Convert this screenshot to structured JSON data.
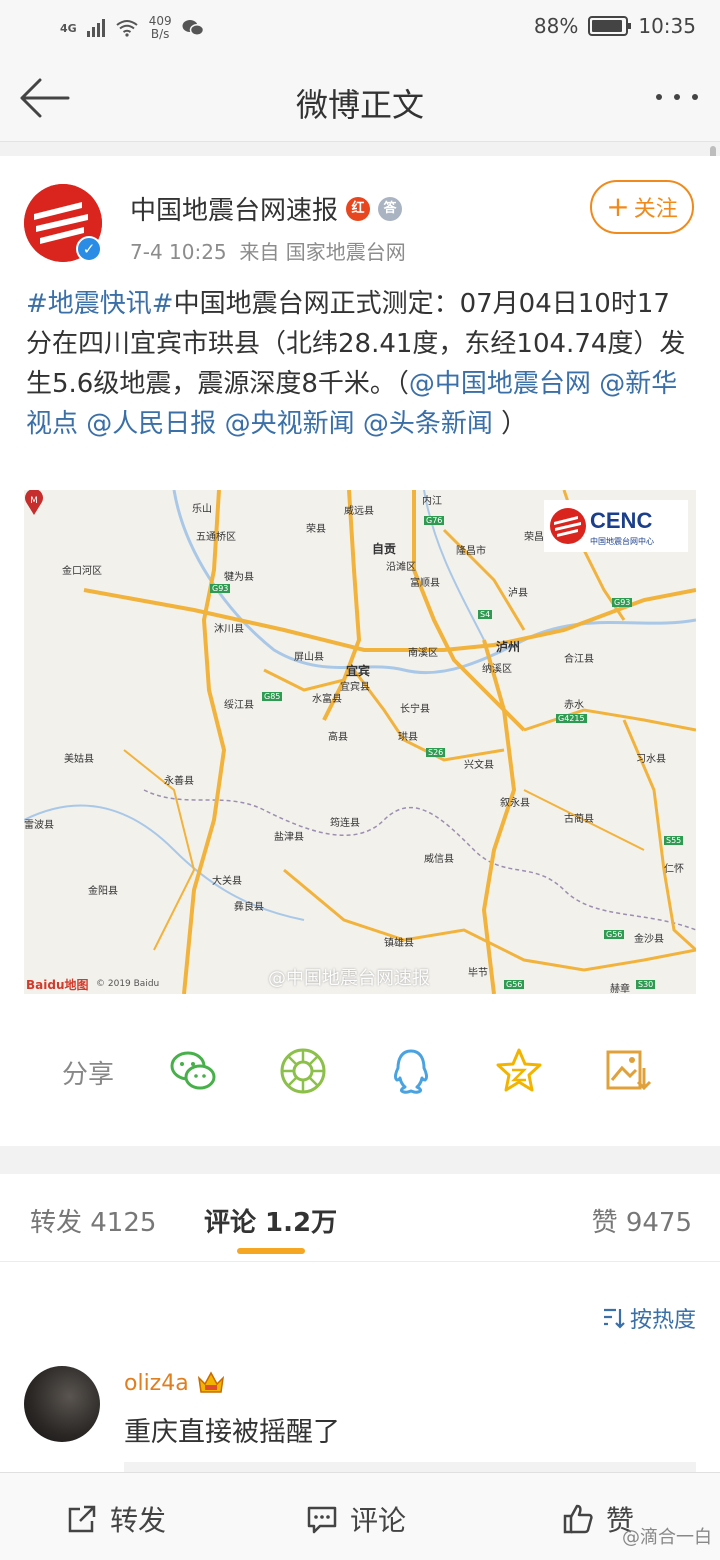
{
  "status": {
    "network": "4G",
    "speed_value": "409",
    "speed_unit": "B/s",
    "battery": "88%",
    "time": "10:35"
  },
  "nav": {
    "title": "微博正文"
  },
  "post": {
    "author": "中国地震台网速报",
    "badge_red": "红",
    "badge_gray": "答",
    "time": "7-4 10:25",
    "source": "来自 国家地震台网",
    "follow_label": "关注",
    "text": {
      "hashtag": "#地震快讯#",
      "body": "中国地震台网正式测定：07月04日10时17分在四川宜宾市珙县（北纬28.41度，东经104.74度）发生5.6级地震，震源深度8千米。（",
      "mention1": "@中国地震台网",
      "mention2": "@新华视点",
      "mention3": "@人民日报",
      "mention4": "@央视新闻",
      "mention5": "@头条新闻",
      "close": "）"
    },
    "map": {
      "logo_text": "CENC",
      "logo_sub": "中国地震台网中心",
      "baidu": "Baidu地图",
      "copyright": "© 2019 Baidu",
      "watermark": "@中国地震台网速报",
      "epicenter_mark": "M",
      "labels": [
        "乐山",
        "威远县",
        "内江",
        "荣县",
        "五通桥区",
        "自贡",
        "隆昌市",
        "荣昌",
        "沿滩区",
        "金口河区",
        "犍为县",
        "富顺县",
        "泸县",
        "沐川县",
        "泸州",
        "合江县",
        "屏山县",
        "宜宾",
        "南溪区",
        "纳溪区",
        "宜宾县",
        "水富县",
        "长宁县",
        "绥江县",
        "高县",
        "珙县",
        "兴文县",
        "赤水",
        "美姑县",
        "永善县",
        "筠连县",
        "叙永县",
        "习水县",
        "古蔺县",
        "盐津县",
        "雷波县",
        "威信县",
        "仁怀",
        "大关县",
        "彝良县",
        "金阳县",
        "镇雄县",
        "毕节",
        "金沙县",
        "赫章",
        "G85",
        "G76",
        "G93",
        "G4215",
        "S26",
        "S55",
        "G56",
        "G56",
        "S30",
        "S4",
        "G93"
      ]
    },
    "share": {
      "label": "分享",
      "icons": [
        "wechat-icon",
        "moments-icon",
        "qq-icon",
        "qzone-icon",
        "save-image-icon"
      ]
    }
  },
  "tabs": {
    "repost": "转发 4125",
    "comment": "评论 1.2万",
    "like": "赞 9475"
  },
  "comments": {
    "sort_label": "按热度",
    "items": [
      {
        "user": "oliz4a",
        "text": "重庆直接被摇醒了"
      }
    ]
  },
  "bottom": {
    "repost": "转发",
    "comment": "评论",
    "like": "赞",
    "watermark": "@滴合一白"
  },
  "colors": {
    "accent": "#f08a1c",
    "link": "#3a6fa8",
    "tab_indicator": "#f5a623"
  }
}
